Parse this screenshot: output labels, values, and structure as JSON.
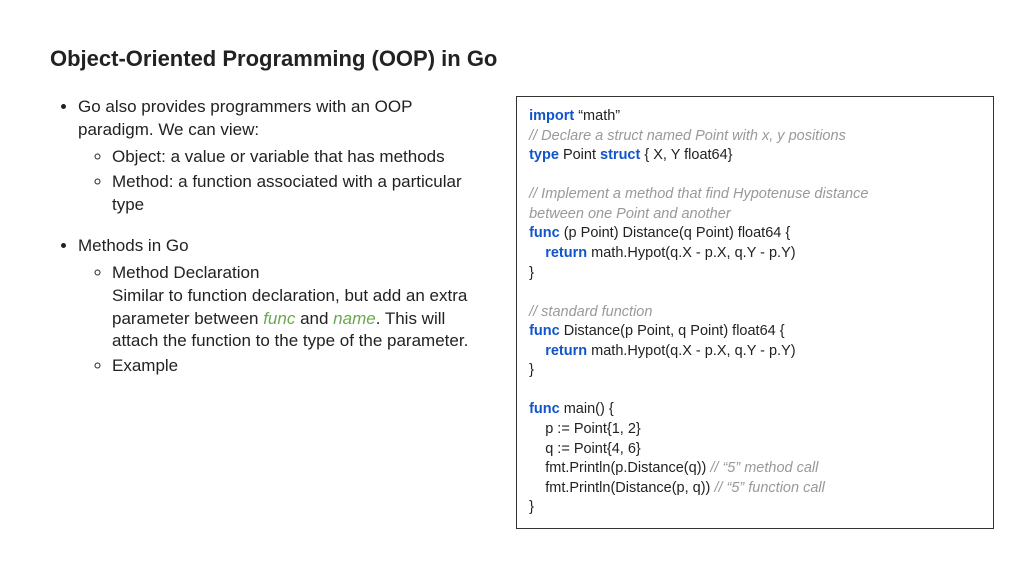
{
  "title": "Object-Oriented Programming (OOP) in Go",
  "left": {
    "b1": "Go also provides programmers with an OOP paradigm. We can view:",
    "b1a": "Object: a value or variable that has methods",
    "b1b": "Method: a function associated with a particular type",
    "b2": "Methods in Go",
    "b2a_head": "Method Declaration",
    "b2a_pre": "Similar to function declaration, but add an extra parameter between ",
    "b2a_func": "func",
    "b2a_mid": " and ",
    "b2a_name": "name",
    "b2a_post": ". This will attach the function to the type of the parameter.",
    "b2b": "Example"
  },
  "code": {
    "kw_import": "import",
    "l1": " “math”",
    "c1": "// Declare a struct named Point with x, y positions",
    "kw_type": "type",
    "l3a": " Point ",
    "kw_struct": "struct",
    "l3b": " { X, Y float64}",
    "c2a": "// Implement a method that find Hypotenuse distance",
    "c2b": "between one Point and another",
    "kw_func": "func",
    "l6": " (p Point) Distance(q Point) float64 {",
    "kw_return": "return",
    "indent": "    ",
    "l7": " math.Hypot(q.X - p.X, q.Y - p.Y)",
    "brace": "}",
    "c3": "// standard function",
    "l10": " Distance(p Point, q Point) float64 {",
    "l13": " main() {",
    "l14": "    p := Point{1, 2}",
    "l15": "    q := Point{4, 6}",
    "l16a": "    fmt.Println(p.Distance(q)) ",
    "c16": "// “5” method call",
    "l17a": "    fmt.Println(Distance(p, q)) ",
    "c17": "// “5” function call"
  }
}
